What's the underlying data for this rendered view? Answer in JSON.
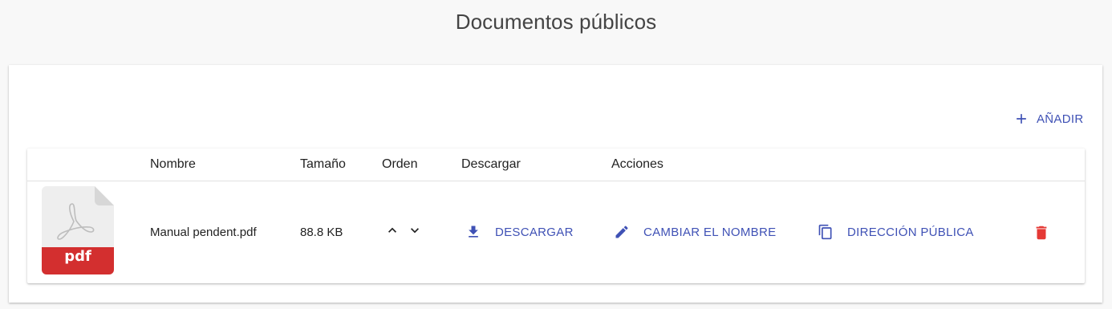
{
  "page": {
    "title": "Documentos públicos"
  },
  "toolbar": {
    "add_label": "AÑADIR",
    "add_icon": "plus-icon"
  },
  "table": {
    "headers": {
      "name": "Nombre",
      "size": "Tamaño",
      "order": "Orden",
      "download": "Descargar",
      "actions": "Acciones"
    },
    "rows": [
      {
        "thumbnail_label": "pdf",
        "name": "Manual pendent.pdf",
        "size": "88.8 KB",
        "download_label": "DESCARGAR",
        "rename_label": "CAMBIAR EL NOMBRE",
        "public_url_label": "DIRECCIÓN PÚBLICA"
      }
    ]
  },
  "colors": {
    "accent": "#3f51b5",
    "danger": "#e53935",
    "pdf_badge": "#d32f2f"
  }
}
